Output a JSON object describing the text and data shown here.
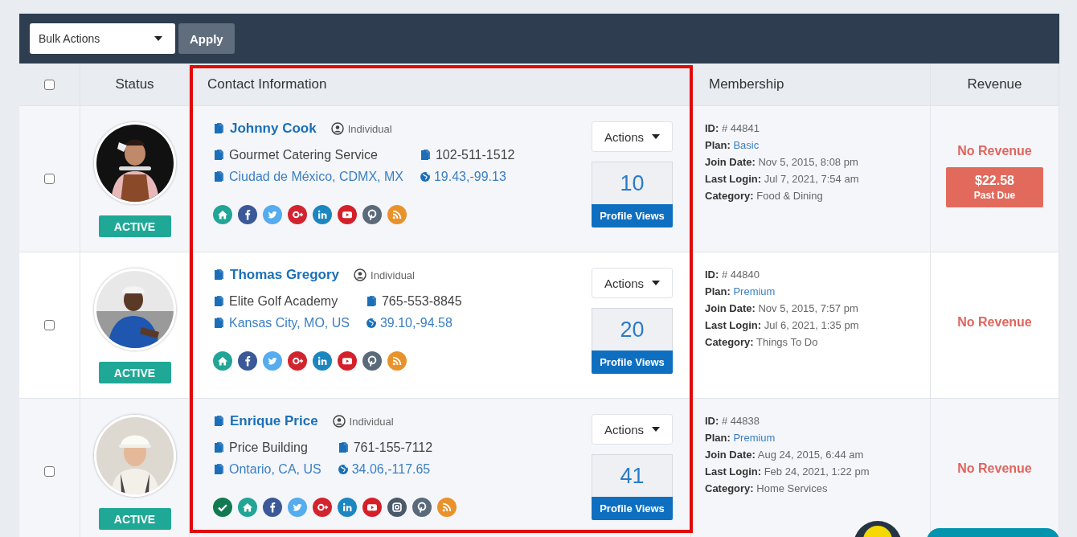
{
  "toolbar": {
    "bulk_actions": "Bulk Actions",
    "apply": "Apply"
  },
  "columns": [
    {
      "kind": "check",
      "checked": false
    },
    {
      "kind": "center",
      "label": "Status"
    },
    {
      "kind": "left",
      "label": "Contact Information",
      "highlighted": true
    },
    {
      "kind": "left",
      "label": "Membership"
    },
    {
      "kind": "center",
      "label": "Revenue"
    }
  ],
  "rows": [
    {
      "checked": false,
      "status": "ACTIVE",
      "name": "Johnny Cook",
      "type": "Individual",
      "company": "Gourmet Catering Service",
      "phone": "102-511-1512",
      "location": "Ciudad de México, CDMX, MX",
      "coords": "19.43,-99.13",
      "socials": [
        {
          "kind": "home"
        },
        {
          "kind": "facebook"
        },
        {
          "kind": "twitter"
        },
        {
          "kind": "google"
        },
        {
          "kind": "linkedin"
        },
        {
          "kind": "youtube"
        },
        {
          "kind": "pinterest"
        },
        {
          "kind": "rss"
        }
      ],
      "actions": "Actions",
      "views": "10",
      "views_label": "Profile Views",
      "membership": [
        {
          "label": "ID:",
          "value": "# 44841",
          "kind": "plain"
        },
        {
          "label": "Plan:",
          "value": "Basic",
          "kind": "link"
        },
        {
          "label": "Join Date:",
          "value": "Nov 5, 2015, 8:08 pm",
          "kind": "plain"
        },
        {
          "label": "Last Login:",
          "value": "Jul 7, 2021, 7:54 am",
          "kind": "plain"
        },
        {
          "label": "Category:",
          "value": "Food & Dining",
          "kind": "plain"
        }
      ],
      "revenue": "No Revenue",
      "past_due": {
        "amount": "$22.58",
        "label": "Past Due"
      }
    },
    {
      "checked": false,
      "status": "ACTIVE",
      "name": "Thomas Gregory",
      "type": "Individual",
      "company": "Elite Golf Academy",
      "phone": "765-553-8845",
      "location": "Kansas City, MO, US",
      "coords": "39.10,-94.58",
      "socials": [
        {
          "kind": "home"
        },
        {
          "kind": "facebook"
        },
        {
          "kind": "twitter"
        },
        {
          "kind": "google"
        },
        {
          "kind": "linkedin"
        },
        {
          "kind": "youtube"
        },
        {
          "kind": "pinterest"
        },
        {
          "kind": "rss"
        }
      ],
      "actions": "Actions",
      "views": "20",
      "views_label": "Profile Views",
      "membership": [
        {
          "label": "ID:",
          "value": "# 44840",
          "kind": "plain"
        },
        {
          "label": "Plan:",
          "value": "Premium",
          "kind": "link"
        },
        {
          "label": "Join Date:",
          "value": "Nov 5, 2015, 7:57 pm",
          "kind": "plain"
        },
        {
          "label": "Last Login:",
          "value": "Jul 6, 2021, 1:35 pm",
          "kind": "plain"
        },
        {
          "label": "Category:",
          "value": "Things To Do",
          "kind": "plain"
        }
      ],
      "revenue": "No Revenue"
    },
    {
      "checked": false,
      "status": "ACTIVE",
      "name": "Enrique Price",
      "type": "Individual",
      "company": "Price Building",
      "phone": "761-155-7112",
      "location": "Ontario, CA, US",
      "coords": "34.06,-117.65",
      "socials": [
        {
          "kind": "verified"
        },
        {
          "kind": "home"
        },
        {
          "kind": "facebook"
        },
        {
          "kind": "twitter"
        },
        {
          "kind": "google"
        },
        {
          "kind": "linkedin"
        },
        {
          "kind": "youtube"
        },
        {
          "kind": "instagram"
        },
        {
          "kind": "pinterest"
        },
        {
          "kind": "rss"
        }
      ],
      "actions": "Actions",
      "views": "41",
      "views_label": "Profile Views",
      "membership": [
        {
          "label": "ID:",
          "value": "# 44838",
          "kind": "plain"
        },
        {
          "label": "Plan:",
          "value": "Premium",
          "kind": "link"
        },
        {
          "label": "Join Date:",
          "value": "Aug 24, 2015, 6:44 am",
          "kind": "plain"
        },
        {
          "label": "Last Login:",
          "value": "Feb 24, 2021, 1:22 pm",
          "kind": "plain"
        },
        {
          "label": "Category:",
          "value": "Home Services",
          "kind": "plain"
        }
      ],
      "revenue": "No Revenue"
    }
  ]
}
